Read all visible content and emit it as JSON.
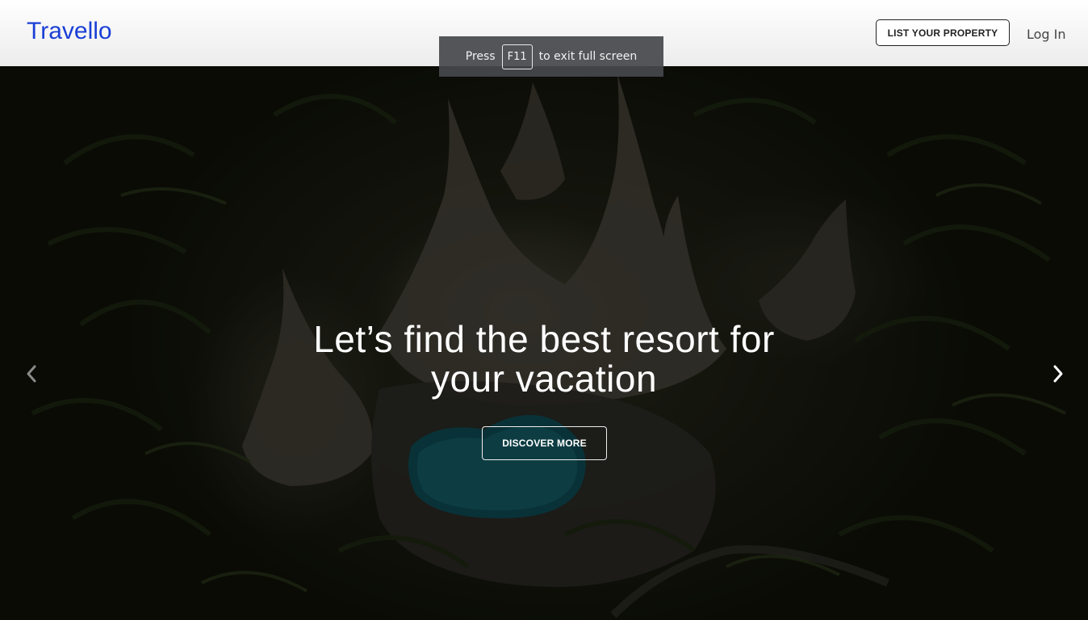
{
  "header": {
    "logo": "Travello",
    "list_property_label": "LIST YOUR PROPERTY",
    "login_label": "Log In",
    "brand_color": "#1a3fd6"
  },
  "fullscreen_notice": {
    "press": "Press",
    "key": "F11",
    "message": "to exit full screen"
  },
  "hero": {
    "headline_line1": "Let’s find the best resort for",
    "headline_line2": "your vacation",
    "cta_label": "DISCOVER MORE",
    "prev_icon": "chevron-left-icon",
    "next_icon": "chevron-right-icon"
  }
}
